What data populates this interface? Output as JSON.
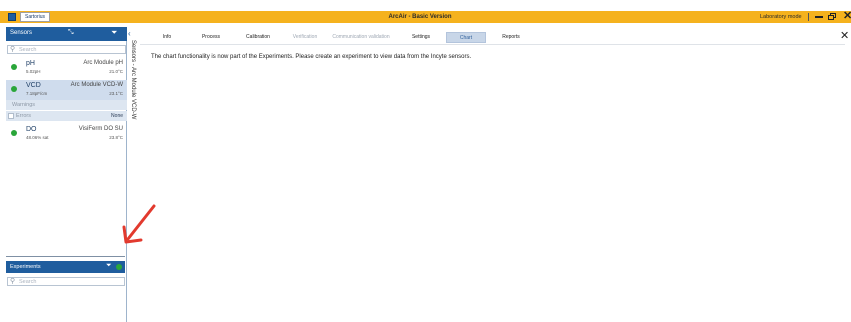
{
  "titlebar": {
    "brand": "Sartorius",
    "title": "ArcAir - Basic Version",
    "mode": "Laboratory mode"
  },
  "sensors": {
    "header": "Sensors",
    "search_placeholder": "Search",
    "items": [
      {
        "name": "pH",
        "value": "5.02pH",
        "type": "Arc Module pH",
        "temp": "21.0°C",
        "status_color": "#2aa63a"
      },
      {
        "name": "VCD",
        "value": "7.18pF/cm",
        "type": "Arc Module VCD-W",
        "temp": "23.1°C",
        "status_color": "#2aa63a"
      },
      {
        "name": "DO",
        "value": "48.06% sat",
        "type": "VisiFerm DO SU",
        "temp": "23.8°C",
        "status_color": "#2aa63a"
      }
    ],
    "sub_rows": {
      "warnings": "Warnings",
      "errors": "Errors",
      "errors_count": "None"
    },
    "vertical_label": "Sensors - Arc Module VCD-W"
  },
  "experiments": {
    "header": "Experiments",
    "search_placeholder": "Search"
  },
  "tabs": [
    {
      "label": "Info",
      "state": "normal"
    },
    {
      "label": "Process",
      "state": "normal"
    },
    {
      "label": "Calibration",
      "state": "normal"
    },
    {
      "label": "Verification",
      "state": "disabled"
    },
    {
      "label": "Communication validation",
      "state": "disabled"
    },
    {
      "label": "Settings",
      "state": "normal"
    },
    {
      "label": "Chart",
      "state": "active"
    },
    {
      "label": "Reports",
      "state": "normal"
    }
  ],
  "main": {
    "message": "The chart functionality is now part of the Experiments. Please create an experiment to view data from the Incyte sensors."
  },
  "colors": {
    "titlebar": "#f5b21e",
    "panel_header": "#1f5d9e",
    "status_ok": "#2aa63a",
    "annotation_arrow": "#e23a2e"
  }
}
